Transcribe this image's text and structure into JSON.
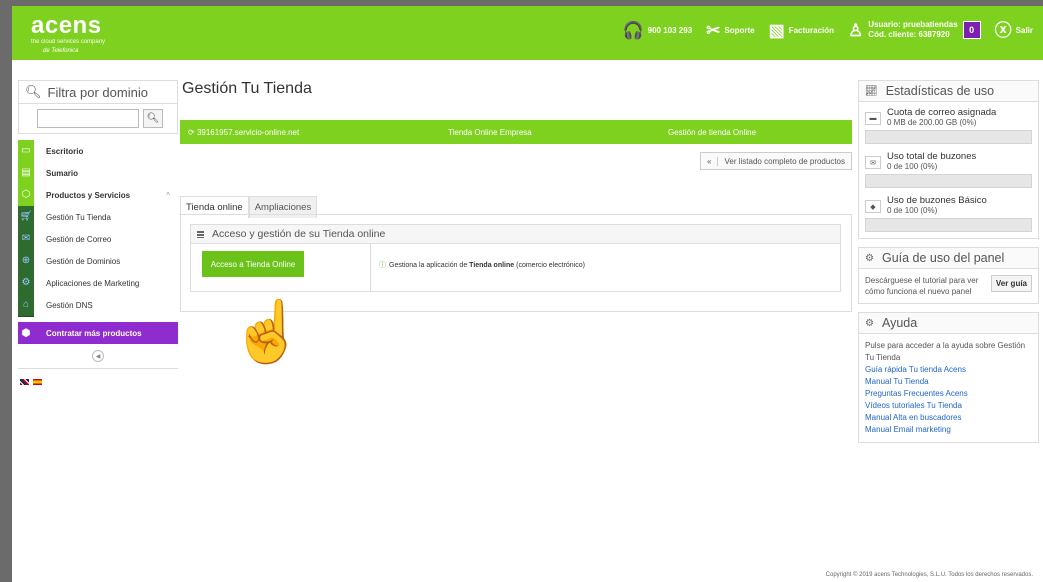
{
  "brand": {
    "logo": "acens",
    "tagline": "the cloud services company",
    "parent": "de Telefonica"
  },
  "topbar": {
    "phone": "900 103 293",
    "support": "Soporte",
    "billing": "Facturación",
    "user_line1": "Usuario: pruebatiendas",
    "user_line2": "Cód. cliente: 6387920",
    "badge": "0",
    "logout": "Salir"
  },
  "sidebar": {
    "filter_title": "Filtra por dominio",
    "filter_value": "",
    "items": [
      {
        "label": "Escritorio",
        "bold": true
      },
      {
        "label": "Sumario",
        "bold": true
      },
      {
        "label": "Productos y Servicios",
        "bold": true
      },
      {
        "label": "Gestión Tu Tienda",
        "bold": false
      },
      {
        "label": "Gestión de Correo",
        "bold": false
      },
      {
        "label": "Gestión de Dominios",
        "bold": false
      },
      {
        "label": "Aplicaciones de Marketing",
        "bold": false
      },
      {
        "label": "Gestión DNS",
        "bold": false
      }
    ],
    "contract": "Contratar más productos"
  },
  "main": {
    "title": "Gestión Tu Tienda",
    "store": {
      "domain": "39161957.servicio-online.net",
      "plan": "Tienda Online Empresa",
      "service": "Gestión de tienda Online"
    },
    "list_button": "Ver listado completo de productos",
    "list_chevron": "«",
    "tabs": [
      "Tienda online",
      "Ampliaciones"
    ],
    "panel_title": "Acceso y gestión de su Tienda online",
    "access_button": "Acceso a Tienda Online",
    "access_desc_prefix": "Gestiona la aplicación de ",
    "access_desc_bold": "Tienda online",
    "access_desc_suffix": " (comercio electrónico)"
  },
  "right": {
    "stats_title": "Estadísticas de uso",
    "stats": [
      {
        "title": "Cuota de correo asignada",
        "value": "0 MB de 200.00 GB (0%)",
        "icon": "hdd-icon",
        "progress": 0
      },
      {
        "title": "Uso total de buzones",
        "value": "0 de 100 (0%)",
        "icon": "mail-icon",
        "progress": 0
      },
      {
        "title": "Uso de buzones Básico",
        "value": "0 de 100 (0%)",
        "icon": "tag-icon",
        "progress": 0
      }
    ],
    "guide_title": "Guía de uso del panel",
    "guide_text": "Descárguese el tutorial para ver cómo funciona el nuevo panel",
    "guide_button": "Ver guía",
    "help_title": "Ayuda",
    "help_intro": "Pulse para acceder a la ayuda sobre Gestión Tu Tienda",
    "help_links": [
      "Guía rápida Tu tienda Acens",
      "Manual Tu Tienda",
      "Preguntas Frecuentes Acens",
      "Vídeos tutoriales Tu Tienda",
      "Manual Alta en buscadores",
      "Manual Email marketing"
    ]
  },
  "footer": {
    "copyright": "Copyright © 2019 acens Technologies, S.L.U. Todos los derechos reservados."
  }
}
